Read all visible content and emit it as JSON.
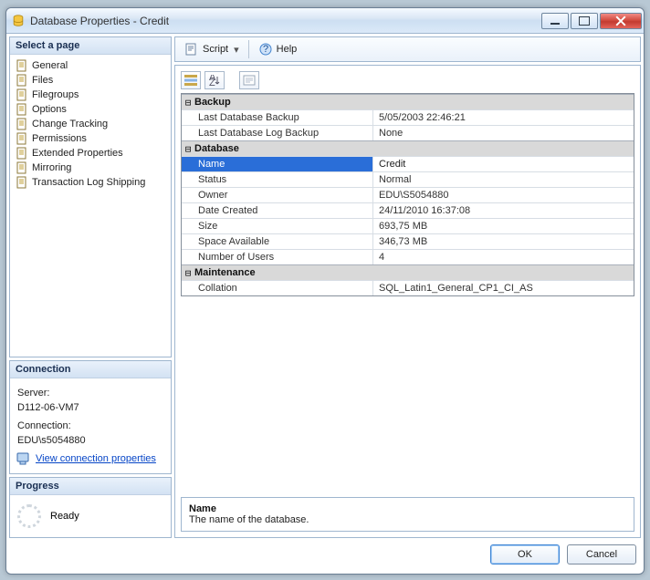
{
  "window": {
    "title": "Database Properties - Credit"
  },
  "toolbar": {
    "script": "Script",
    "help": "Help"
  },
  "sidebar": {
    "select_page": "Select a page",
    "items": [
      {
        "label": "General"
      },
      {
        "label": "Files"
      },
      {
        "label": "Filegroups"
      },
      {
        "label": "Options"
      },
      {
        "label": "Change Tracking"
      },
      {
        "label": "Permissions"
      },
      {
        "label": "Extended Properties"
      },
      {
        "label": "Mirroring"
      },
      {
        "label": "Transaction Log Shipping"
      }
    ]
  },
  "connection": {
    "header": "Connection",
    "server_label": "Server:",
    "server_value": "D112-06-VM7",
    "conn_label": "Connection:",
    "conn_value": "EDU\\s5054880",
    "view_props_link": "View connection properties"
  },
  "progress": {
    "header": "Progress",
    "status": "Ready"
  },
  "grid": {
    "cats": {
      "backup": {
        "label": "Backup",
        "rows": [
          {
            "k": "Last Database Backup",
            "v": "5/05/2003 22:46:21"
          },
          {
            "k": "Last Database Log Backup",
            "v": "None"
          }
        ]
      },
      "database": {
        "label": "Database",
        "rows": [
          {
            "k": "Name",
            "v": "Credit",
            "selected": true
          },
          {
            "k": "Status",
            "v": "Normal"
          },
          {
            "k": "Owner",
            "v": "EDU\\S5054880"
          },
          {
            "k": "Date Created",
            "v": "24/11/2010 16:37:08"
          },
          {
            "k": "Size",
            "v": "693,75 MB"
          },
          {
            "k": "Space Available",
            "v": "346,73 MB"
          },
          {
            "k": "Number of Users",
            "v": "4"
          }
        ]
      },
      "maintenance": {
        "label": "Maintenance",
        "rows": [
          {
            "k": "Collation",
            "v": "SQL_Latin1_General_CP1_CI_AS"
          }
        ]
      }
    }
  },
  "description": {
    "name": "Name",
    "text": "The name of the database."
  },
  "buttons": {
    "ok": "OK",
    "cancel": "Cancel"
  },
  "icons": {
    "toggle": "⊟"
  }
}
